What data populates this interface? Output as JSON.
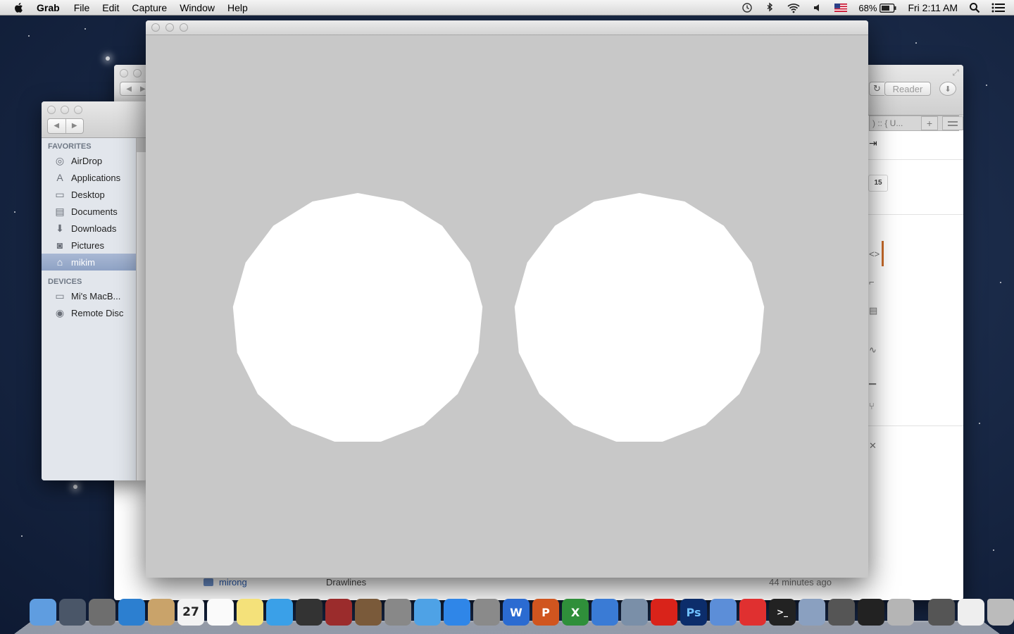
{
  "menubar": {
    "app_name": "Grab",
    "menus": [
      "File",
      "Edit",
      "Capture",
      "Window",
      "Help"
    ],
    "battery": "68%",
    "clock": "Fri 2:11 AM"
  },
  "safari": {
    "reader_label": "Reader",
    "tab_label": ") :: { U...",
    "badge": "15",
    "list_row": {
      "name": "mirong",
      "kind": "Drawlines",
      "modified": "44 minutes ago"
    }
  },
  "finder": {
    "favorites_header": "FAVORITES",
    "favorites": [
      {
        "label": "AirDrop",
        "icon": "airdrop-icon"
      },
      {
        "label": "Applications",
        "icon": "applications-icon"
      },
      {
        "label": "Desktop",
        "icon": "desktop-icon"
      },
      {
        "label": "Documents",
        "icon": "documents-icon"
      },
      {
        "label": "Downloads",
        "icon": "downloads-icon"
      },
      {
        "label": "Pictures",
        "icon": "pictures-icon"
      },
      {
        "label": "mikim",
        "icon": "home-icon",
        "selected": true
      }
    ],
    "devices_header": "DEVICES",
    "devices": [
      {
        "label": "Mi's MacB...",
        "icon": "laptop-icon"
      },
      {
        "label": "Remote Disc",
        "icon": "disc-icon"
      }
    ]
  },
  "grab_canvas": {
    "background": "#c8c8c8",
    "shape_color": "#ffffff",
    "polygon_sides": 17
  },
  "dock": {
    "icons": [
      "finder-icon",
      "launchpad-icon",
      "mission-control-icon",
      "safari-icon",
      "contacts-icon",
      "calendar-icon",
      "reminders-icon",
      "notes-icon",
      "messages-icon",
      "facetime-icon",
      "photo-booth-icon",
      "iphoto-icon",
      "image-capture-icon",
      "itunes-icon",
      "app-store-icon",
      "system-preferences-icon",
      "word-icon",
      "powerpoint-icon",
      "excel-icon",
      "bluetooth-icon",
      "preview-icon",
      "acrobat-icon",
      "photoshop-icon",
      "xcode-icon",
      "acrobat-reader-icon",
      "terminal-icon",
      "preview-photos-icon",
      "github-icon",
      "openframeworks-icon",
      "grab-icon",
      "printer-icon",
      "documents-stack-icon",
      "trash-icon"
    ],
    "calendar_day": "27"
  }
}
